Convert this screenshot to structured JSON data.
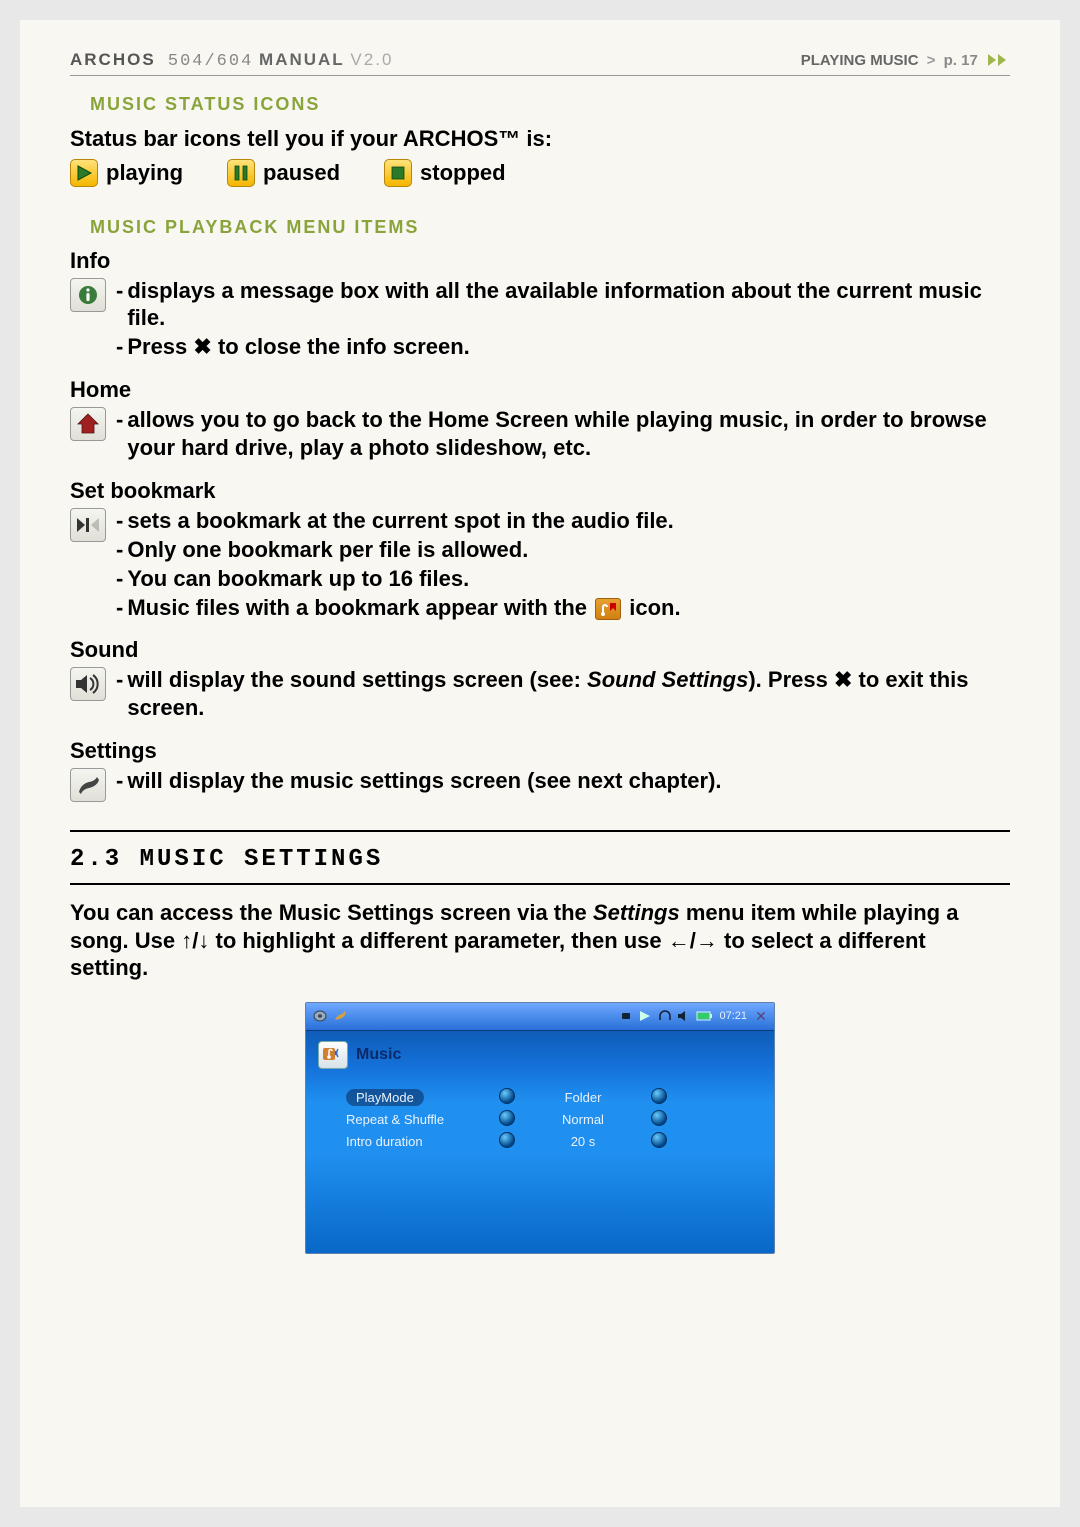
{
  "header": {
    "brand": "ARCHOS",
    "model": "504/604",
    "manual": "MANUAL",
    "version": "V2.0",
    "section": "PLAYING MUSIC",
    "page_label": "p. 17"
  },
  "sec1_heading": "MUSIC STATUS ICONS",
  "status_intro": "Status bar icons tell you if your ARCHOS™ is:",
  "status": {
    "playing": "playing",
    "paused": "paused",
    "stopped": "stopped"
  },
  "sec2_heading": "MUSIC PLAYBACK MENU ITEMS",
  "info": {
    "label": "Info",
    "b1a": "displays a message box with all the available information about the current music file.",
    "b2a": "Press ",
    "b2c": " to close the info screen."
  },
  "home": {
    "label": "Home",
    "b1": "allows you to go back to the Home Screen while playing music, in order to browse your hard drive, play a photo slideshow, etc."
  },
  "bookmark": {
    "label": "Set bookmark",
    "b1": "sets a bookmark at the current spot in the audio file.",
    "b2": "Only one bookmark per file is allowed.",
    "b3": "You can bookmark up to 16 files.",
    "b4a": "Music files with a bookmark appear with the ",
    "b4c": " icon."
  },
  "sound": {
    "label": "Sound",
    "b1a": "will display the sound settings screen (see: ",
    "b1b": "Sound Settings",
    "b1c": "). Press ",
    "b1e": " to exit this screen."
  },
  "settings": {
    "label": "Settings",
    "b1": "will display the music settings screen (see next chapter)."
  },
  "chapter_heading": "2.3  MUSIC SETTINGS",
  "para1a": "You can access the Music Settings screen via the ",
  "para1b": "Settings",
  "para1c": " menu item while playing a song. Use ",
  "para1d": " to highlight a different parameter, then use ",
  "para1e": " to select a different setting.",
  "screenshot": {
    "title": "Music",
    "time": "07:21",
    "rows": [
      {
        "label": "PlayMode",
        "value": "Folder",
        "selected": true
      },
      {
        "label": "Repeat & Shuffle",
        "value": "Normal",
        "selected": false
      },
      {
        "label": "Intro duration",
        "value": "20 s",
        "selected": false
      }
    ]
  }
}
